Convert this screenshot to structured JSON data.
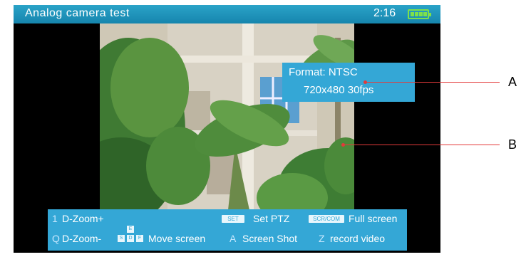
{
  "titlebar": {
    "title": "Analog camera test",
    "time": "2:16",
    "battery_icon": "battery-full-icon"
  },
  "overlay": {
    "format_line": "Format: NTSC",
    "resolution_line": "720x480 30fps"
  },
  "bottom_bar": {
    "zoom_in_key": "1",
    "zoom_in_label": "D-Zoom+",
    "set_badge": "SET",
    "set_ptz_label": "Set PTZ",
    "scr_badge": "SCR/COM",
    "fullscreen_label": "Full screen",
    "zoom_out_key": "Q",
    "zoom_out_label": "D-Zoom-",
    "move_keys": [
      "E",
      "S",
      "D",
      "F"
    ],
    "move_label": "Move screen",
    "screenshot_key": "A",
    "screenshot_label": "Screen Shot",
    "record_key": "Z",
    "record_label": "record video"
  },
  "callouts": {
    "a": "A",
    "b": "B"
  },
  "colors": {
    "titlebar": "#1d8fb8",
    "overlay": "#34a7d6",
    "callout": "#e43a3a",
    "battery": "#7ee04a"
  }
}
